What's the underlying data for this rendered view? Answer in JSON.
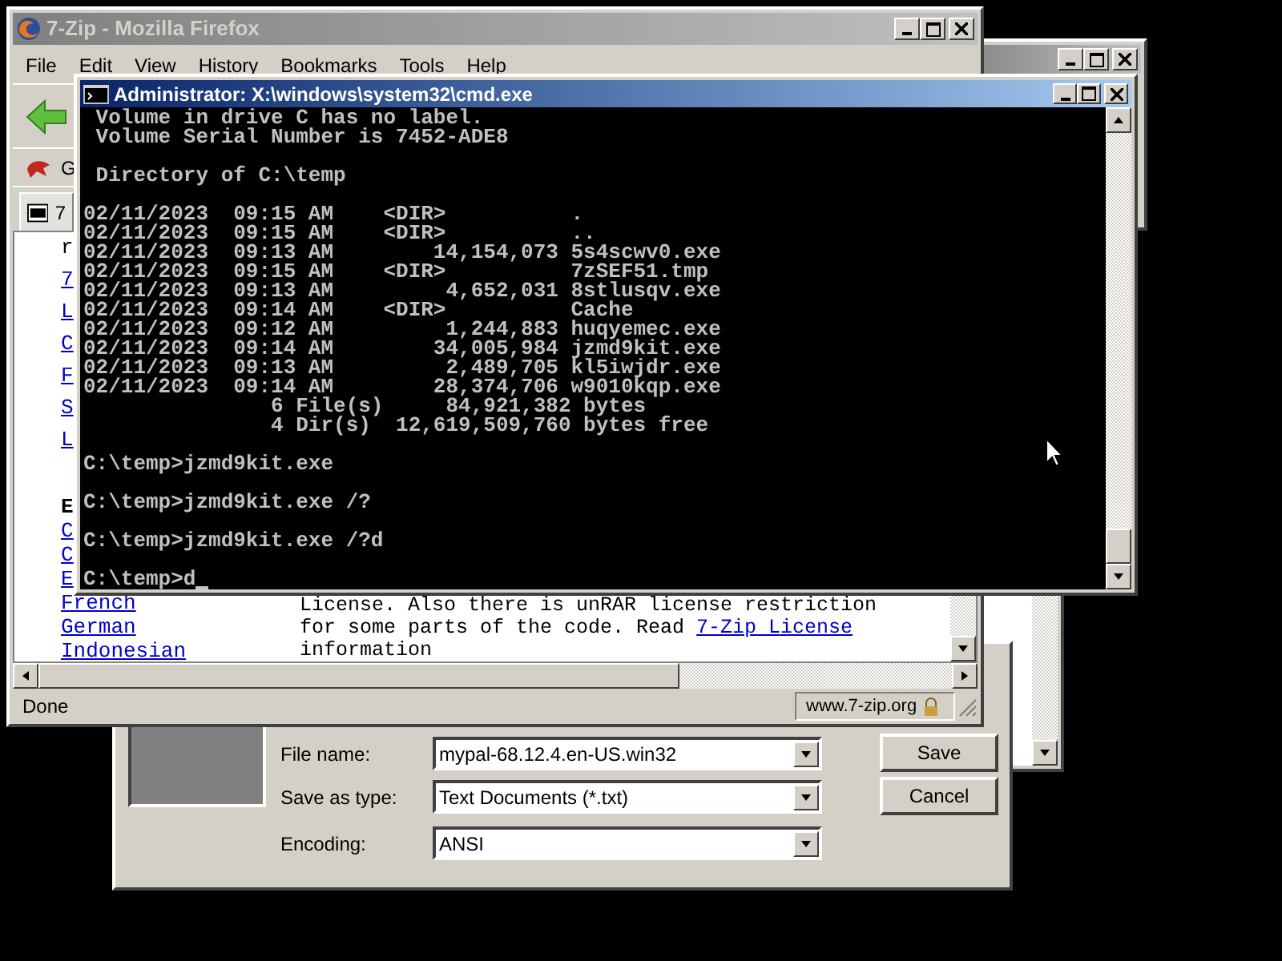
{
  "firefox": {
    "title": "7-Zip - Mozilla Firefox",
    "active": false,
    "menu": [
      "File",
      "Edit",
      "View",
      "History",
      "Bookmarks",
      "Tools",
      "Help"
    ],
    "bookmarks": [
      {
        "label": "G"
      }
    ],
    "tabs": [
      {
        "label": "7",
        "selected": true
      }
    ],
    "left_fragments": [
      {
        "text": "r",
        "kind": "text"
      },
      {
        "text": "7",
        "kind": "link"
      },
      {
        "text": "L",
        "kind": "link"
      },
      {
        "text": "C",
        "kind": "link"
      },
      {
        "text": "F",
        "kind": "link"
      },
      {
        "text": "S",
        "kind": "link"
      },
      {
        "text": "L",
        "kind": "link"
      }
    ],
    "left_heading": "E",
    "left_links": [
      "C",
      "C",
      "E",
      "French",
      "German",
      "Indonesian"
    ],
    "body_lines": [
      {
        "text": "License. Also there is unRAR license restriction"
      },
      {
        "text": "for some parts of the code. Read ",
        "link": "7-Zip License"
      },
      {
        "text": "information"
      }
    ],
    "status": {
      "text": "Done",
      "url": "www.7-zip.org"
    }
  },
  "save_dialog": {
    "fields": [
      {
        "label": "File name:",
        "value": "mypal-68.12.4.en-US.win32"
      },
      {
        "label": "Save as type:",
        "value": "Text Documents (*.txt)"
      },
      {
        "label": "Encoding:",
        "value": "ANSI"
      }
    ],
    "buttons": [
      "Save",
      "Cancel"
    ]
  },
  "console": {
    "title": "Administrator: X:\\windows\\system32\\cmd.exe",
    "active": true,
    "blocks": [
      [
        " Volume in drive C has no label.",
        " Volume Serial Number is 7452-ADE8"
      ],
      [
        " Directory of C:\\temp"
      ],
      [
        "02/11/2023  09:15 AM    <DIR>          .",
        "02/11/2023  09:15 AM    <DIR>          ..",
        "02/11/2023  09:13 AM        14,154,073 5s4scwv0.exe",
        "02/11/2023  09:15 AM    <DIR>          7zSEF51.tmp",
        "02/11/2023  09:13 AM         4,652,031 8stlusqv.exe",
        "02/11/2023  09:14 AM    <DIR>          Cache",
        "02/11/2023  09:12 AM         1,244,883 huqyemec.exe",
        "02/11/2023  09:14 AM        34,005,984 jzmd9kit.exe",
        "02/11/2023  09:13 AM         2,489,705 kl5iwjdr.exe",
        "02/11/2023  09:14 AM        28,374,706 w9010kqp.exe",
        "               6 File(s)     84,921,382 bytes",
        "               4 Dir(s)  12,619,509,760 bytes free"
      ],
      [
        "C:\\temp>jzmd9kit.exe"
      ],
      [
        "C:\\temp>jzmd9kit.exe /?"
      ],
      [
        "C:\\temp>jzmd9kit.exe /?d"
      ],
      [
        "C:\\temp>d"
      ]
    ]
  }
}
